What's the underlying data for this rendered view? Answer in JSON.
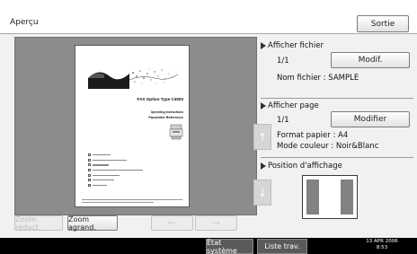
{
  "header": {
    "title": "Aperçu",
    "exit_label": "Sortie"
  },
  "preview": {
    "document": {
      "title": "FAX Option Type C4500",
      "subtitle1": "Operating Instructions",
      "subtitle2": "Facsimile Reference"
    },
    "zoom_reduce_label": "Zoom réduct.",
    "zoom_enlarge_label": "Zoom agrand.",
    "scroll_up_icon": "arrow-up-icon",
    "scroll_down_icon": "arrow-down-icon",
    "prev_icon": "arrow-left-icon",
    "next_icon": "arrow-right-icon"
  },
  "file_section": {
    "heading": "Afficher fichier",
    "counter": "1/1",
    "modify_label": "Modif.",
    "filename": "Nom fichier : SAMPLE"
  },
  "page_section": {
    "heading": "Afficher page",
    "counter": "1/1",
    "modify_label": "Modifier",
    "paper_format": "Format papier : A4",
    "color_mode": "Mode couleur : Noir&Blanc"
  },
  "position_section": {
    "heading": "Position d'affichage"
  },
  "statusbar": {
    "system_status_label": "État système",
    "job_list_label": "Liste trav.",
    "date": "13 APR 2006",
    "time": "8:53"
  },
  "colors": {
    "preview_bg": "#8c8c8c",
    "status_bg": "#000000"
  }
}
